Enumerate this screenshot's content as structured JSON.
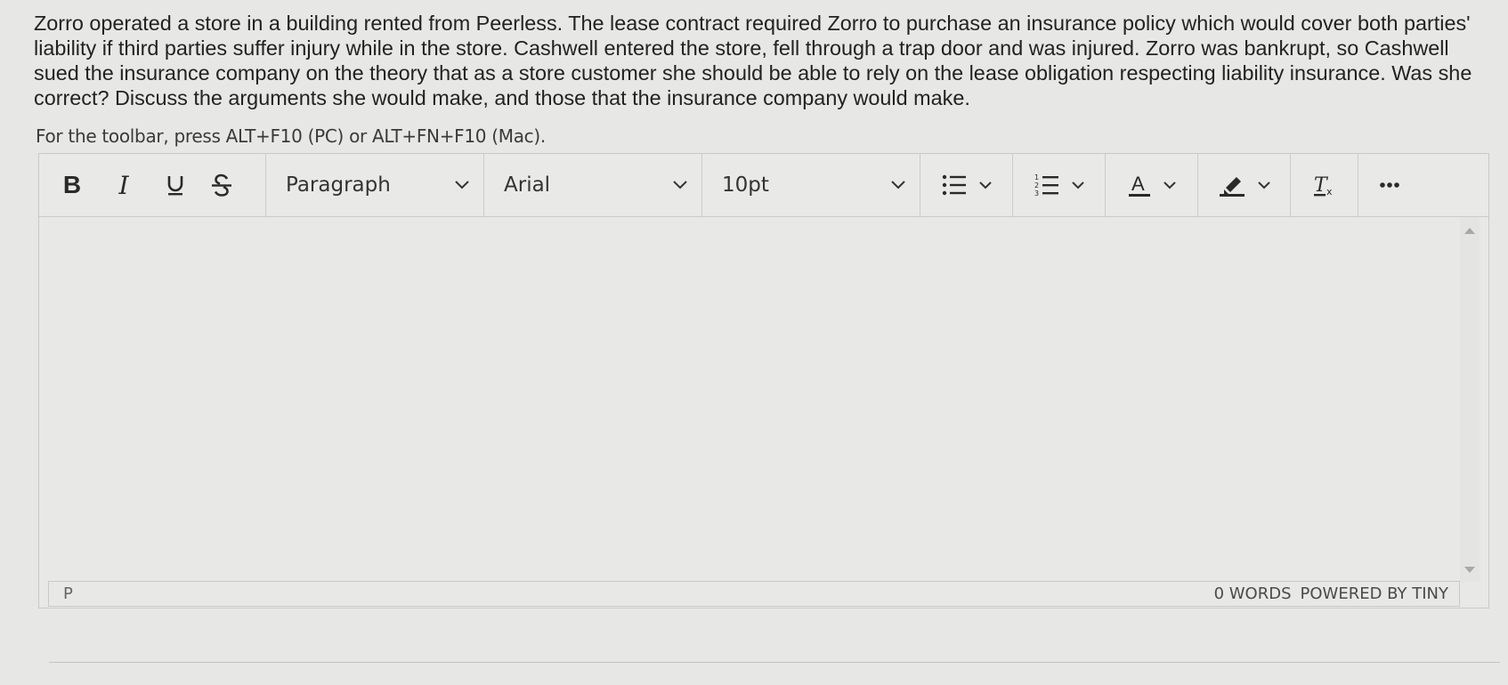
{
  "question": {
    "lines": [
      "Zorro operated a store in a building rented from Peerless. The lease contract required Zorro to purchase an insurance policy which would cover both parties'",
      "liability if third parties suffer injury while in the store. Cashwell entered the store, fell through a trap door and was injured. Zorro was bankrupt, so Cashwell",
      "sued the insurance company on the theory that as a store customer she should be able to rely on the lease obligation respecting liability insurance. Was she",
      "correct? Discuss the arguments she would make, and those that the insurance company would make."
    ]
  },
  "hint": "For the toolbar, press ALT+F10 (PC) or ALT+FN+F10 (Mac).",
  "toolbar": {
    "bold_label": "B",
    "italic_label": "I",
    "underline_icon": "underline-icon",
    "strikethrough_icon": "strikethrough-icon",
    "block_format": "Paragraph",
    "font_family": "Arial",
    "font_size": "10pt",
    "bullet_list_icon": "bullet-list-icon",
    "numbered_list_icon": "numbered-list-icon",
    "text_color_icon": "text-color-icon",
    "highlight_icon": "highlight-icon",
    "clear_format_icon": "clear-formatting-icon",
    "more_icon": "more-icon"
  },
  "statusbar": {
    "path": "P",
    "word_count": "0 WORDS",
    "powered_by": "POWERED BY TINY"
  },
  "colors": {
    "background": "#e7e7e5",
    "border": "#c9c9c7",
    "icon": "#2a2a2a"
  }
}
